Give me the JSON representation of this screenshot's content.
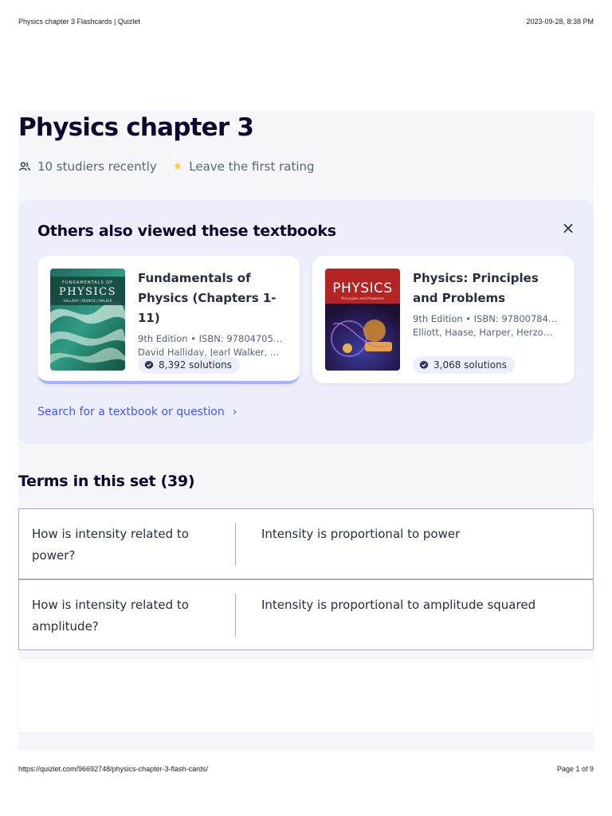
{
  "print": {
    "title": "Physics chapter 3 Flashcards | Quizlet",
    "datetime": "2023-09-28, 8:38 PM",
    "url": "https://quizlet.com/96692748/physics-chapter-3-flash-cards/",
    "page": "Page 1 of 9"
  },
  "set": {
    "title": "Physics chapter 3",
    "studiers": "10 studiers recently",
    "rating": "Leave the first rating"
  },
  "textbooks": {
    "title": "Others also viewed these textbooks",
    "close_label": "×",
    "items": [
      {
        "name": "Fundamentals of Physics (Chapters 1-11)",
        "edition_isbn": "9th Edition • ISBN: 97804705…",
        "authors": "David Halliday, Jearl Walker, …",
        "solutions": "8,392 solutions",
        "cover_text": "PHYSICS",
        "cover_top": "FUNDAMENTALS OF",
        "cover_authors": "HALLIDAY | RESNICK | WALKER"
      },
      {
        "name": "Physics: Principles and Problems",
        "edition_isbn": "9th Edition • ISBN: 97800784…",
        "authors": "Elliott, Haase, Harper, Herzo…",
        "solutions": "3,068 solutions",
        "cover_text": "PHYSICS",
        "cover_sub": "Principles and Problems"
      }
    ],
    "search_link": "Search for a textbook or question"
  },
  "terms": {
    "title": "Terms in this set (39)",
    "rows": [
      {
        "term": "How is intensity related to power?",
        "definition": "Intensity is proportional to power"
      },
      {
        "term": "How is intensity related to amplitude?",
        "definition": "Intensity is proportional to amplitude squared"
      }
    ]
  },
  "colors": {
    "accent": "#4255ff",
    "panel": "#edeffc",
    "star": "#ffcd1f",
    "title": "#0a092d"
  }
}
